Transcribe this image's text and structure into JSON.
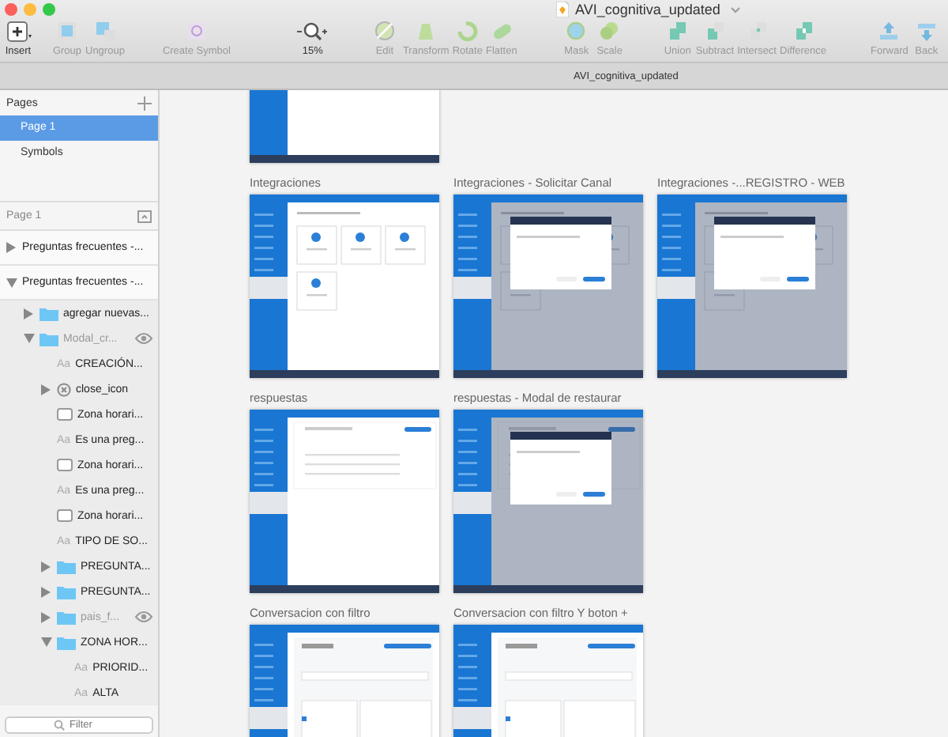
{
  "window": {
    "title": "AVI_cognitiva_updated"
  },
  "toolbar": [
    {
      "label": "Insert",
      "disabled": false
    },
    {
      "label": "Group",
      "disabled": true
    },
    {
      "label": "Ungroup",
      "disabled": true
    },
    {
      "label": "Create Symbol",
      "disabled": true
    },
    {
      "label": "15%",
      "disabled": false
    },
    {
      "label": "Edit",
      "disabled": true
    },
    {
      "label": "Transform",
      "disabled": true
    },
    {
      "label": "Rotate",
      "disabled": true
    },
    {
      "label": "Flatten",
      "disabled": true
    },
    {
      "label": "Mask",
      "disabled": true
    },
    {
      "label": "Scale",
      "disabled": true
    },
    {
      "label": "Union",
      "disabled": true
    },
    {
      "label": "Subtract",
      "disabled": true
    },
    {
      "label": "Intersect",
      "disabled": true
    },
    {
      "label": "Difference",
      "disabled": true
    },
    {
      "label": "Forward",
      "disabled": true
    },
    {
      "label": "Back",
      "disabled": true
    }
  ],
  "document_tab": "AVI_cognitiva_updated",
  "pages": {
    "title": "Pages",
    "items": [
      {
        "label": "Page 1",
        "selected": true
      },
      {
        "label": "Symbols",
        "selected": false
      }
    ]
  },
  "layers": {
    "title": "Page 1",
    "items": [
      {
        "label": "Preguntas frecuentes -...",
        "kind": "artboard",
        "expanded": false,
        "hidden": false
      },
      {
        "label": "Preguntas frecuentes -...",
        "kind": "artboard",
        "expanded": true,
        "hidden": false,
        "children": [
          {
            "label": "agregar nuevas...",
            "kind": "group",
            "expanded": false,
            "hidden": false
          },
          {
            "label": "Modal_cr...",
            "kind": "group",
            "expanded": true,
            "hidden": true,
            "children": [
              {
                "label": "CREACIÓN...",
                "kind": "text",
                "badge": "Aa",
                "hidden": false
              },
              {
                "label": "close_icon",
                "kind": "symbol",
                "expanded": false,
                "hidden": false
              },
              {
                "label": "Zona horari...",
                "kind": "shape",
                "hidden": false
              },
              {
                "label": "Es una preg...",
                "kind": "text",
                "badge": "Aa",
                "hidden": false
              },
              {
                "label": "Zona horari...",
                "kind": "shape",
                "hidden": false
              },
              {
                "label": "Es una preg...",
                "kind": "text",
                "badge": "Aa",
                "hidden": false
              },
              {
                "label": "Zona horari...",
                "kind": "shape",
                "hidden": false
              },
              {
                "label": "TIPO DE SO...",
                "kind": "text",
                "badge": "Aa",
                "hidden": false
              },
              {
                "label": "PREGUNTA...",
                "kind": "group",
                "expanded": false,
                "hidden": false
              },
              {
                "label": "PREGUNTA...",
                "kind": "group",
                "expanded": false,
                "hidden": false
              },
              {
                "label": "pais_f...",
                "kind": "group",
                "expanded": false,
                "hidden": true
              },
              {
                "label": "ZONA HOR...",
                "kind": "group",
                "expanded": true,
                "hidden": false,
                "children": [
                  {
                    "label": "PRIORID...",
                    "kind": "text",
                    "badge": "Aa",
                    "hidden": false
                  },
                  {
                    "label": "ALTA",
                    "kind": "text",
                    "badge": "Aa",
                    "hidden": false
                  }
                ]
              }
            ]
          }
        ]
      }
    ]
  },
  "filter": {
    "placeholder": "Filter"
  },
  "artboards": [
    [
      {
        "kind": "form"
      }
    ],
    [
      {
        "title": "Integraciones",
        "kind": "cards"
      },
      {
        "title": "Integraciones - Solicitar Canal",
        "kind": "cards-modal"
      },
      {
        "title": "Integraciones -...REGISTRO - WEB",
        "kind": "cards-modal"
      }
    ],
    [
      {
        "title": "respuestas",
        "kind": "list"
      },
      {
        "title": "respuestas - Modal de restaurar",
        "kind": "list-modal"
      }
    ],
    [
      {
        "title": "Conversacion con filtro",
        "kind": "chat"
      },
      {
        "title": "Conversacion con filtro Y boton +",
        "kind": "chat"
      }
    ]
  ]
}
